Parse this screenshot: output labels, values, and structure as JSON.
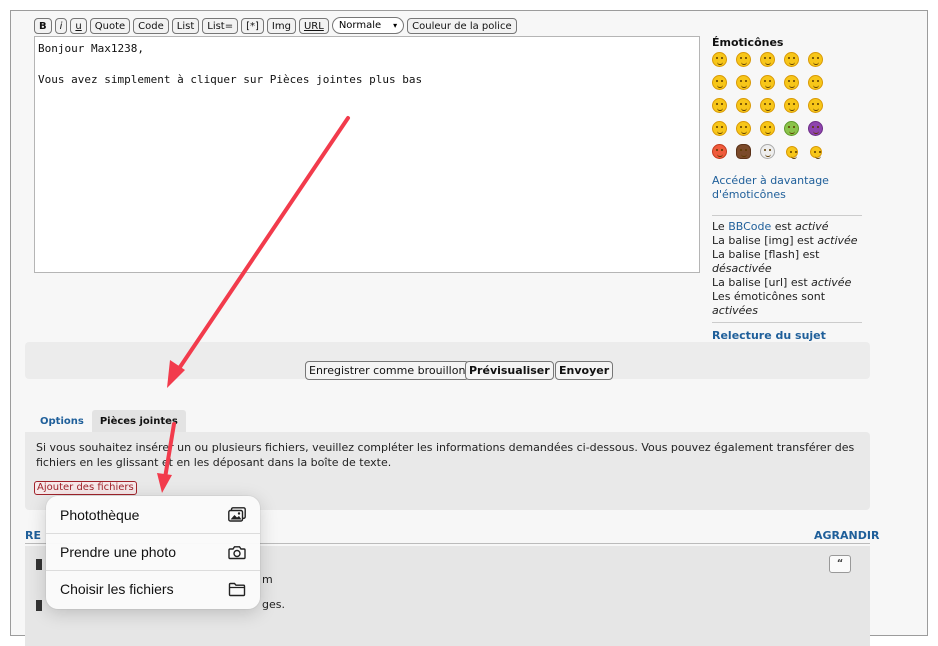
{
  "toolbar": {
    "bold": "B",
    "italic": "i",
    "underline": "u",
    "quote": "Quote",
    "code": "Code",
    "list": "List",
    "list_eq": "List=",
    "list_item": "[*]",
    "img": "Img",
    "url": "URL",
    "size_select": "Normale",
    "font_color": "Couleur de la police"
  },
  "editor": {
    "text": "Bonjour Max1238,\n\nVous avez simplement à cliquer sur Pièces jointes plus bas"
  },
  "smilies": {
    "title": "Émoticônes",
    "more_link": "Accéder à davantage d'émoticônes"
  },
  "bbcode_info": {
    "line1_prefix": "Le ",
    "line1_link": "BBCode",
    "line1_mid": " est ",
    "line1_state": "activé",
    "line2_prefix": "La balise [img] est ",
    "line2_state": "activée",
    "line3_prefix": "La balise [flash] est ",
    "line3_state": "désactivée",
    "line4_prefix": "La balise [url] est ",
    "line4_state": "activée",
    "line5_prefix": "Les émoticônes sont ",
    "line5_state": "activées"
  },
  "topic_review": "Relecture du sujet",
  "actions": {
    "save_draft": "Enregistrer comme brouillon",
    "preview": "Prévisualiser",
    "submit": "Envoyer"
  },
  "tabs": {
    "options": "Options",
    "attachments": "Pièces jointes"
  },
  "attachments": {
    "help_text": "Si vous souhaitez insérer un ou plusieurs fichiers, veuillez compléter les informations demandées ci-dessous. Vous pouvez également transférer des fichiers en les glissant et en les déposant dans la boîte de texte.",
    "add_button": "Ajouter des fichiers"
  },
  "review": {
    "label": "RE",
    "expand": "AGRANDIR",
    "fragment1": "m",
    "fragment2": "ges."
  },
  "file_menu": {
    "items": [
      {
        "label": "Photothèque",
        "icon": "photo-library-icon"
      },
      {
        "label": "Prendre une photo",
        "icon": "camera-icon"
      },
      {
        "label": "Choisir les fichiers",
        "icon": "folder-icon"
      }
    ]
  },
  "colors": {
    "link": "#1f5f9a",
    "arrow": "#f23b4c",
    "add_button": "#a1232b"
  }
}
